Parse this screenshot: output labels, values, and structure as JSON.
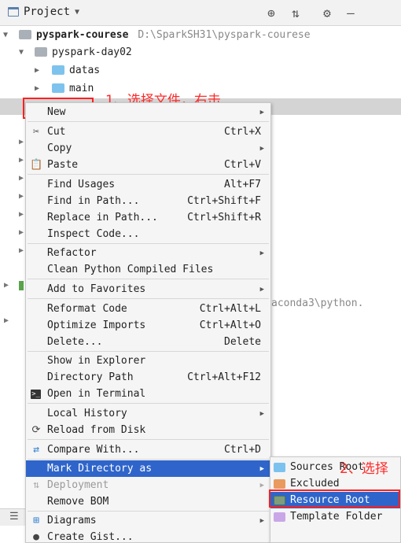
{
  "toolbar": {
    "title": "Project"
  },
  "tree": {
    "project_name": "pyspark-courese",
    "project_path": "D:\\SparkSH31\\pyspark-courese",
    "day_folder": "pyspark-day02",
    "datas_folder": "datas",
    "main_folder": "main",
    "python_path_fragment": "aconda3\\python."
  },
  "annotations": {
    "step1": "1、选择文件，右击",
    "step2": "2、选择"
  },
  "context_menu": {
    "items": [
      {
        "label": "New",
        "shortcut": "",
        "submenu": true
      },
      {
        "label": "Cut",
        "shortcut": "Ctrl+X",
        "icon": "scissors-icon"
      },
      {
        "label": "Copy",
        "shortcut": "",
        "submenu": true
      },
      {
        "label": "Paste",
        "shortcut": "Ctrl+V",
        "icon": "clipboard-icon"
      },
      {
        "label": "Find Usages",
        "shortcut": "Alt+F7"
      },
      {
        "label": "Find in Path...",
        "shortcut": "Ctrl+Shift+F"
      },
      {
        "label": "Replace in Path...",
        "shortcut": "Ctrl+Shift+R"
      },
      {
        "label": "Inspect Code..."
      },
      {
        "label": "Refactor",
        "submenu": true
      },
      {
        "label": "Clean Python Compiled Files"
      },
      {
        "label": "Add to Favorites",
        "submenu": true
      },
      {
        "label": "Reformat Code",
        "shortcut": "Ctrl+Alt+L"
      },
      {
        "label": "Optimize Imports",
        "shortcut": "Ctrl+Alt+O"
      },
      {
        "label": "Delete...",
        "shortcut": "Delete"
      },
      {
        "label": "Show in Explorer"
      },
      {
        "label": "Directory Path",
        "shortcut": "Ctrl+Alt+F12"
      },
      {
        "label": "Open in Terminal",
        "icon": "terminal-icon"
      },
      {
        "label": "Local History",
        "submenu": true
      },
      {
        "label": "Reload from Disk",
        "icon": "reload-icon"
      },
      {
        "label": "Compare With...",
        "shortcut": "Ctrl+D",
        "icon": "compare-icon"
      },
      {
        "label": "Mark Directory as",
        "submenu": true,
        "active": true
      },
      {
        "label": "Deployment",
        "submenu": true,
        "disabled": true,
        "icon": "deployment-icon"
      },
      {
        "label": "Remove BOM"
      },
      {
        "label": "Diagrams",
        "submenu": true,
        "icon": "diagram-icon"
      },
      {
        "label": "Create Gist...",
        "icon": "github-icon"
      }
    ]
  },
  "mark_submenu": {
    "items": [
      {
        "label": "Sources Root",
        "color": "#7cc2ee"
      },
      {
        "label": "Excluded",
        "color": "#e99a5e"
      },
      {
        "label": "Resource Root",
        "color": "#7d9d7d",
        "active": true
      },
      {
        "label": "Template Folder",
        "color": "#c9a6e8"
      }
    ]
  },
  "colors": {
    "accent": "#2f65ca",
    "annotation": "#ff2020"
  }
}
